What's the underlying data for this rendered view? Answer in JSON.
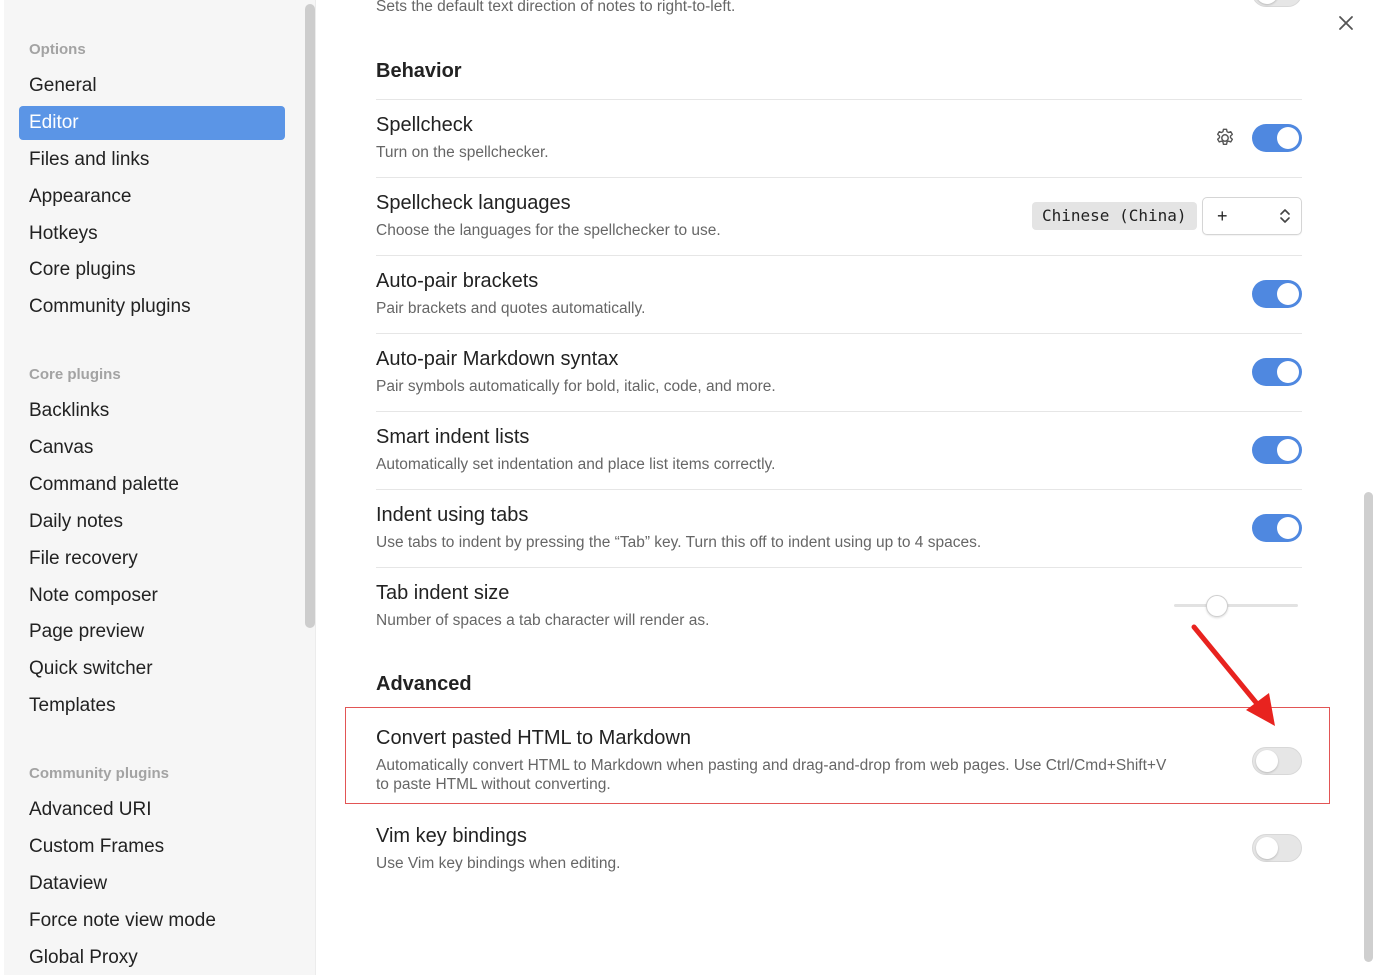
{
  "sidebar": {
    "options_header": "Options",
    "options_items": [
      "General",
      "Editor",
      "Files and links",
      "Appearance",
      "Hotkeys",
      "Core plugins",
      "Community plugins"
    ],
    "active_item": "Editor",
    "core_header": "Core plugins",
    "core_items": [
      "Backlinks",
      "Canvas",
      "Command palette",
      "Daily notes",
      "File recovery",
      "Note composer",
      "Page preview",
      "Quick switcher",
      "Templates"
    ],
    "community_header": "Community plugins",
    "community_items": [
      "Advanced URI",
      "Custom Frames",
      "Dataview",
      "Force note view mode",
      "Global Proxy"
    ]
  },
  "main": {
    "top_cut_desc": "Sets the default text direction of notes to right-to-left.",
    "behavior_title": "Behavior",
    "advanced_title": "Advanced",
    "settings": {
      "spellcheck": {
        "name": "Spellcheck",
        "desc": "Turn on the spellchecker.",
        "on": true
      },
      "spell_langs": {
        "name": "Spellcheck languages",
        "desc": "Choose the languages for the spellchecker to use.",
        "chip": "Chinese (China)",
        "select_value": "+"
      },
      "autopair_brackets": {
        "name": "Auto-pair brackets",
        "desc": "Pair brackets and quotes automatically.",
        "on": true
      },
      "autopair_md": {
        "name": "Auto-pair Markdown syntax",
        "desc": "Pair symbols automatically for bold, italic, code, and more.",
        "on": true
      },
      "smart_indent": {
        "name": "Smart indent lists",
        "desc": "Automatically set indentation and place list items correctly.",
        "on": true
      },
      "indent_tabs": {
        "name": "Indent using tabs",
        "desc": "Use tabs to indent by pressing the “Tab” key. Turn this off to indent using up to 4 spaces.",
        "on": true
      },
      "tab_size": {
        "name": "Tab indent size",
        "desc": "Number of spaces a tab character will render as.",
        "slider_fraction": 0.35
      },
      "convert_html": {
        "name": "Convert pasted HTML to Markdown",
        "desc_line1": "Automatically convert HTML to Markdown when pasting and drag-and-drop from web pages. Use Ctrl/Cmd+Shift+V",
        "desc_line2": "to paste HTML without converting.",
        "on": false
      },
      "vim": {
        "name": "Vim key bindings",
        "desc": "Use Vim key bindings when editing.",
        "on": false
      }
    }
  },
  "icons": {
    "close": "close-icon",
    "gear": "gear-icon",
    "select": "chevron-updown-icon"
  },
  "colors": {
    "accent": "#4f88e0",
    "active_nav": "#5b95e6",
    "annotation": "#e8231f"
  }
}
